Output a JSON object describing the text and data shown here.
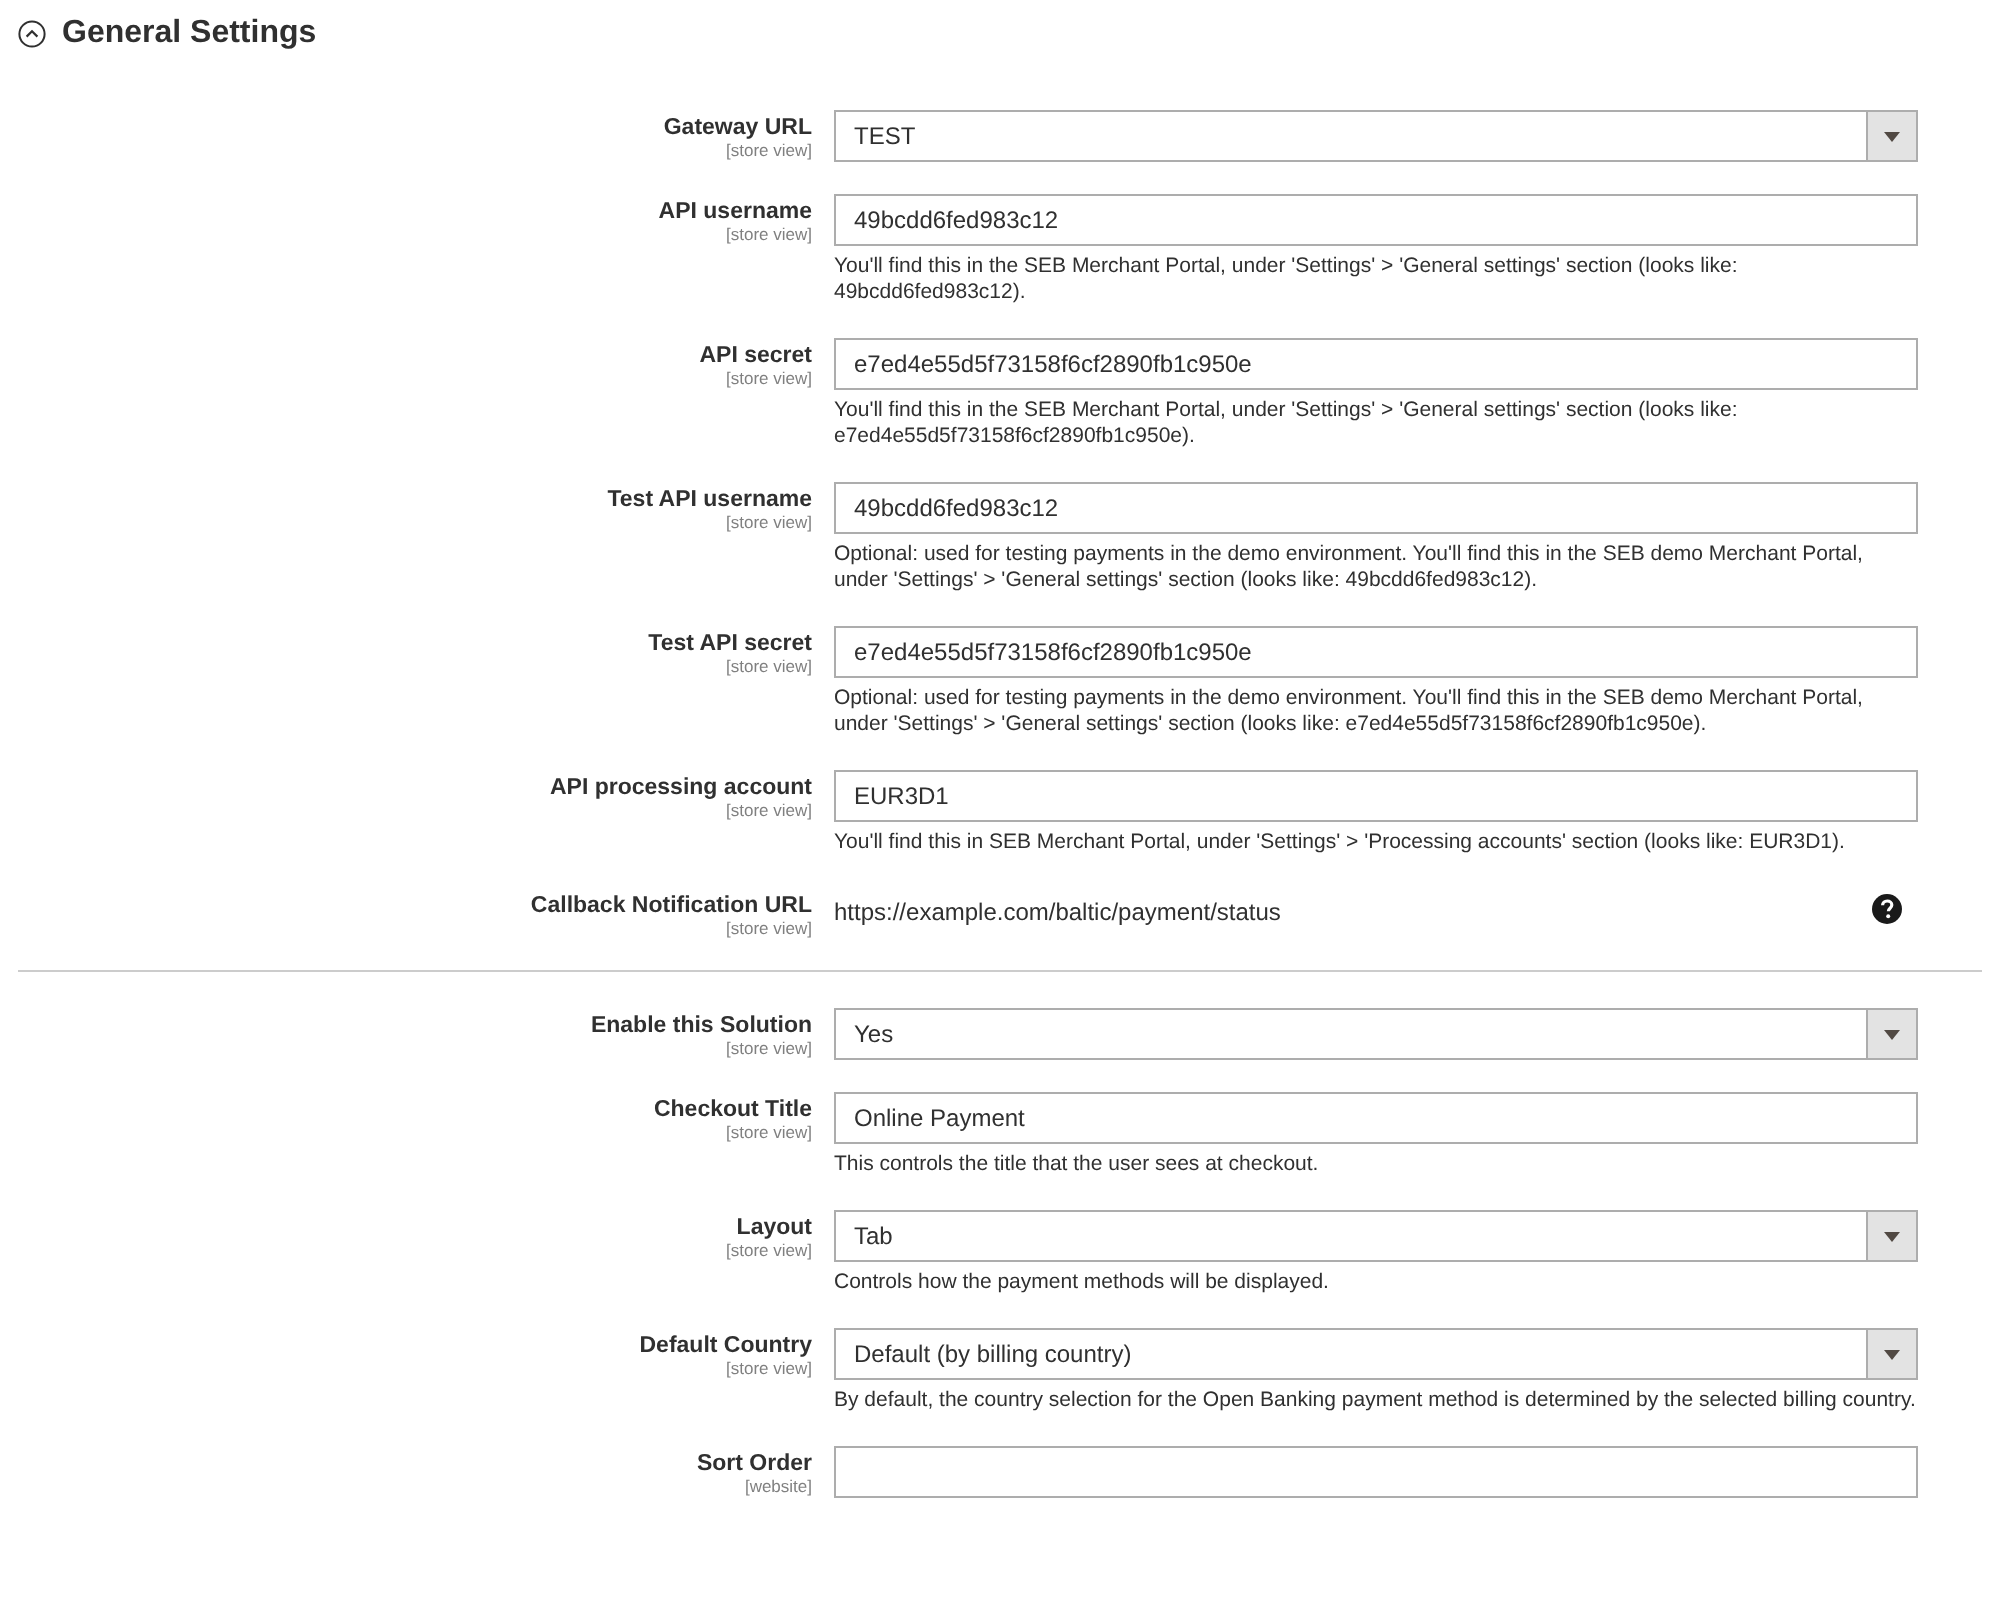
{
  "section": {
    "title": "General Settings",
    "expanded": true
  },
  "groups": [
    {
      "fields": [
        {
          "kind": "select",
          "label": "Gateway URL",
          "scope": "[store view]",
          "value": "TEST"
        },
        {
          "kind": "text",
          "label": "API username",
          "scope": "[store view]",
          "value": "49bcdd6fed983c12",
          "help": "You'll find this in the SEB Merchant Portal, under 'Settings' > 'General settings' section (looks like: 49bcdd6fed983c12)."
        },
        {
          "kind": "text",
          "label": "API secret",
          "scope": "[store view]",
          "value": "e7ed4e55d5f73158f6cf2890fb1c950e",
          "help": "You'll find this in the SEB Merchant Portal, under 'Settings' > 'General settings' section (looks like: e7ed4e55d5f73158f6cf2890fb1c950e)."
        },
        {
          "kind": "text",
          "label": "Test API username",
          "scope": "[store view]",
          "value": "49bcdd6fed983c12",
          "help": "Optional: used for testing payments in the demo environment. You'll find this in the SEB demo Merchant Portal, under 'Settings' > 'General settings' section (looks like: 49bcdd6fed983c12)."
        },
        {
          "kind": "text",
          "label": "Test API secret",
          "scope": "[store view]",
          "value": "e7ed4e55d5f73158f6cf2890fb1c950e",
          "help": "Optional: used for testing payments in the demo environment. You'll find this in the SEB demo Merchant Portal, under 'Settings' > 'General settings' section (looks like: e7ed4e55d5f73158f6cf2890fb1c950e)."
        },
        {
          "kind": "text",
          "label": "API processing account",
          "scope": "[store view]",
          "value": "EUR3D1",
          "help": "You'll find this in SEB Merchant Portal, under 'Settings' > 'Processing accounts' section (looks like: EUR3D1)."
        },
        {
          "kind": "static",
          "label": "Callback Notification URL",
          "scope": "[store view]",
          "value": "https://example.com/baltic/payment/status",
          "tooltip": true
        }
      ]
    },
    {
      "fields": [
        {
          "kind": "select",
          "label": "Enable this Solution",
          "scope": "[store view]",
          "value": "Yes"
        },
        {
          "kind": "text",
          "label": "Checkout Title",
          "scope": "[store view]",
          "value": "Online Payment",
          "help": "This controls the title that the user sees at checkout."
        },
        {
          "kind": "select",
          "label": "Layout",
          "scope": "[store view]",
          "value": "Tab",
          "help": "Controls how the payment methods will be displayed."
        },
        {
          "kind": "select",
          "label": "Default Country",
          "scope": "[store view]",
          "value": "Default (by billing country)",
          "help": "By default, the country selection for the Open Banking payment method is determined by the selected billing country."
        },
        {
          "kind": "text",
          "label": "Sort Order",
          "scope": "[website]"
        }
      ]
    }
  ]
}
